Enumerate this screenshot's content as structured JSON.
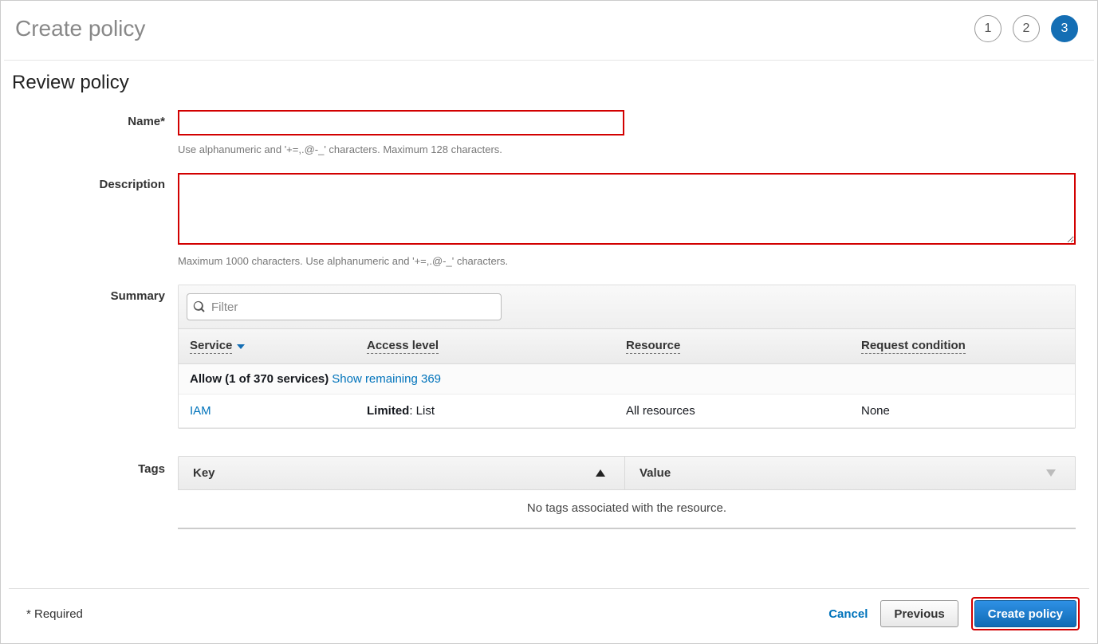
{
  "header": {
    "title": "Create policy",
    "steps": [
      "1",
      "2",
      "3"
    ],
    "active_step_index": 2
  },
  "section_title": "Review policy",
  "name": {
    "label": "Name*",
    "value": "",
    "hint": "Use alphanumeric and '+=,.@-_' characters. Maximum 128 characters."
  },
  "description": {
    "label": "Description",
    "value": "",
    "hint": "Maximum 1000 characters. Use alphanumeric and '+=,.@-_' characters."
  },
  "summary": {
    "label": "Summary",
    "filter_placeholder": "Filter",
    "columns": {
      "service": "Service",
      "access": "Access level",
      "resource": "Resource",
      "condition": "Request condition"
    },
    "allow_text_bold": "Allow (1 of 370 services)",
    "show_remaining": "Show remaining 369",
    "rows": [
      {
        "service": "IAM",
        "access_bold": "Limited",
        "access_rest": ": List",
        "resource": "All resources",
        "condition": "None"
      }
    ]
  },
  "tags": {
    "label": "Tags",
    "cols": {
      "key": "Key",
      "value": "Value"
    },
    "empty": "No tags associated with the resource."
  },
  "footer": {
    "required": "* Required",
    "cancel": "Cancel",
    "previous": "Previous",
    "create": "Create policy"
  }
}
